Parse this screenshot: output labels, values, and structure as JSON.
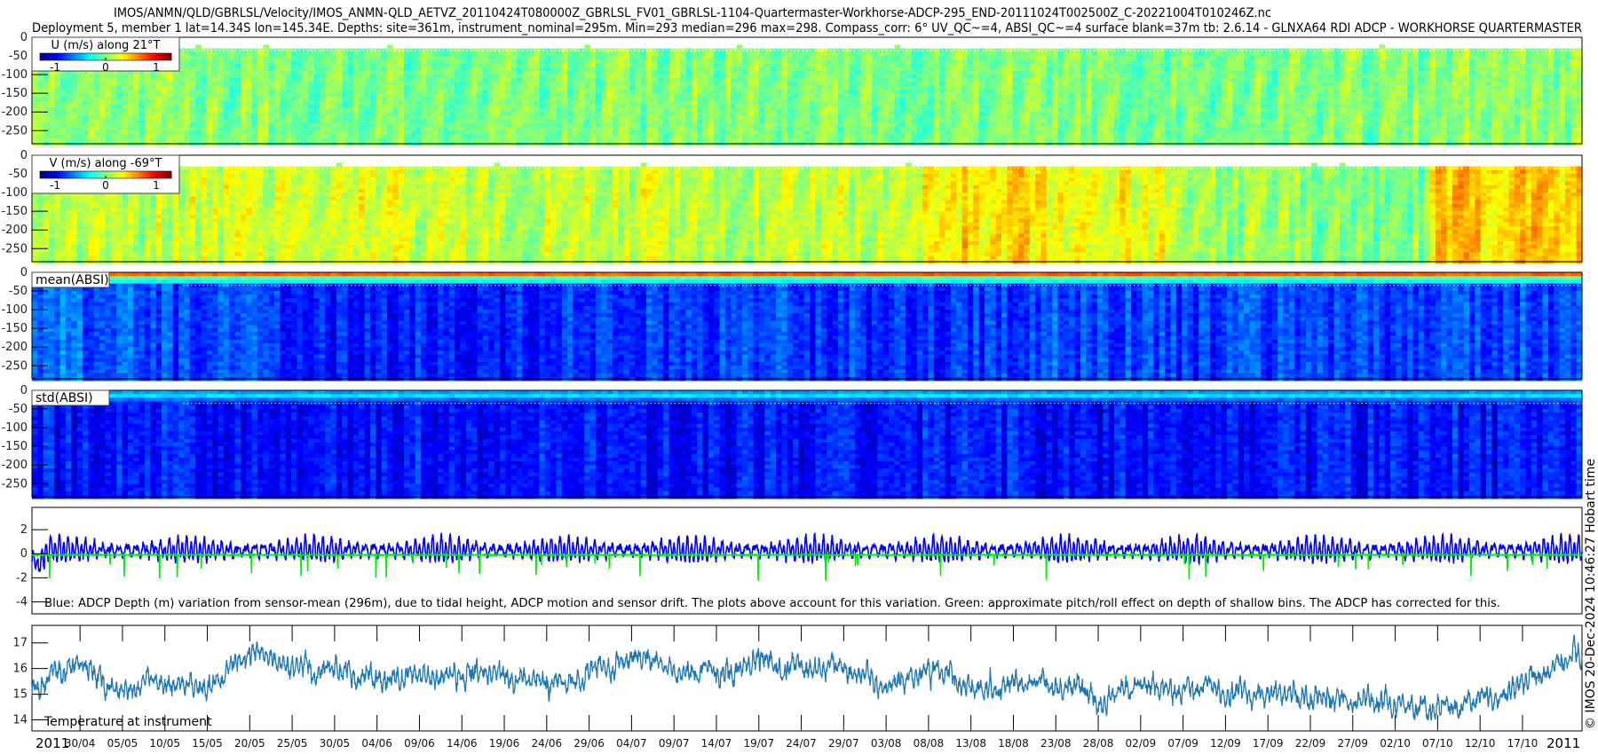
{
  "title": {
    "line1": "IMOS/ANMN/QLD/GBRLSL/Velocity/IMOS_ANMN-QLD_AETVZ_20110424T080000Z_GBRLSL_FV01_GBRLSL-1104-Quartermaster-Workhorse-ADCP-295_END-20111024T002500Z_C-20221004T010246Z.nc",
    "line2": "Deployment 5, member 1 lat=14.34S lon=145.34E. Depths: site=361m, instrument_nominal=295m. Min=293 median=296 max=298. Compass_corr: 6° UV_QC~=4, ABSI_QC~=4 surface blank=37m tb: 2.6.14 - GLNXA64 RDI ADCP - WORKHORSE QUARTERMASTER"
  },
  "credit": "© IMOS 20-Dec-2024 10:46:27 Hobart time",
  "colormap": "jet",
  "colors": {
    "depth_variation": "#0000ff",
    "pitch_roll": "#00ee00",
    "temperature": "#1f77b4",
    "surface_blank_line": "#ffffff"
  },
  "time_axis": {
    "start": "2011-04-24T08:00Z",
    "end": "2011-10-24T00:25Z",
    "year_label_left": "2011",
    "year_label_right": "2011",
    "ticks": [
      "30/04",
      "05/05",
      "10/05",
      "15/05",
      "20/05",
      "25/05",
      "30/05",
      "04/06",
      "09/06",
      "14/06",
      "19/06",
      "24/06",
      "29/06",
      "04/07",
      "09/07",
      "14/07",
      "19/07",
      "24/07",
      "29/07",
      "03/08",
      "08/08",
      "13/08",
      "18/08",
      "23/08",
      "28/08",
      "02/09",
      "07/09",
      "12/09",
      "17/09",
      "22/09",
      "27/09",
      "02/10",
      "07/10",
      "12/10",
      "17/10"
    ]
  },
  "chart_data": [
    {
      "type": "heatmap",
      "label": "U (m/s) along 21°T",
      "colorbar": {
        "ticks": [
          "-1",
          "0",
          "1"
        ],
        "tick_values": [
          -1,
          0,
          1
        ],
        "clim": [
          -1.3,
          1.3
        ]
      },
      "ylim": [
        -285,
        0
      ],
      "yticks": [
        0,
        -50,
        -100,
        -150,
        -200,
        -250
      ],
      "surface_blank_m": 37,
      "depths": [
        -40,
        -90,
        -140,
        -190,
        -240,
        -285
      ],
      "time_segment_start_dates": [
        "24/04",
        "09/05",
        "24/05",
        "08/06",
        "23/06",
        "08/07",
        "23/07",
        "07/08",
        "22/08",
        "06/09",
        "21/09",
        "06/10"
      ],
      "values": [
        [
          0.0,
          0.02,
          0.0,
          0.01,
          0.0,
          0.02,
          0.01,
          0.0,
          0.0,
          0.01,
          0.0,
          0.05
        ],
        [
          0.0,
          0.01,
          0.0,
          0.0,
          0.0,
          0.01,
          0.0,
          0.0,
          0.0,
          0.0,
          0.0,
          0.03
        ],
        [
          0.0,
          0.0,
          0.0,
          0.0,
          0.0,
          0.0,
          0.0,
          0.0,
          0.0,
          0.0,
          0.0,
          0.02
        ],
        [
          0.0,
          0.0,
          0.0,
          0.0,
          0.0,
          0.0,
          0.0,
          0.0,
          0.0,
          0.0,
          0.0,
          0.0
        ],
        [
          0.0,
          0.0,
          0.0,
          0.0,
          0.0,
          0.0,
          0.0,
          0.0,
          0.0,
          0.0,
          0.0,
          0.0
        ],
        [
          0.0,
          0.0,
          0.0,
          0.0,
          0.0,
          0.0,
          0.0,
          0.0,
          0.0,
          0.0,
          0.0,
          0.0
        ]
      ]
    },
    {
      "type": "heatmap",
      "label": "V (m/s) along -69°T",
      "colorbar": {
        "ticks": [
          "-1",
          "0",
          "1"
        ],
        "tick_values": [
          -1,
          0,
          1
        ],
        "clim": [
          -1.3,
          1.3
        ]
      },
      "ylim": [
        -285,
        0
      ],
      "yticks": [
        0,
        -50,
        -100,
        -150,
        -200,
        -250
      ],
      "surface_blank_m": 37,
      "depths": [
        -40,
        -90,
        -140,
        -190,
        -240,
        -285
      ],
      "time_segment_start_dates": [
        "24/04",
        "09/05",
        "24/05",
        "08/06",
        "23/06",
        "08/07",
        "23/07",
        "07/08",
        "22/08",
        "06/09",
        "21/09",
        "06/10"
      ],
      "values": [
        [
          0.15,
          0.2,
          0.25,
          0.15,
          0.2,
          0.15,
          0.2,
          0.4,
          0.3,
          0.05,
          0.0,
          0.45
        ],
        [
          0.15,
          0.2,
          0.2,
          0.15,
          0.15,
          0.15,
          0.15,
          0.25,
          0.0,
          -0.1,
          -0.15,
          0.25
        ],
        [
          0.15,
          0.15,
          0.15,
          0.1,
          0.1,
          0.1,
          0.1,
          0.1,
          -0.15,
          -0.2,
          -0.2,
          0.1
        ],
        [
          0.15,
          0.15,
          0.15,
          0.1,
          0.1,
          0.1,
          0.05,
          0.0,
          -0.2,
          -0.2,
          -0.15,
          0.05
        ],
        [
          0.1,
          0.15,
          0.15,
          0.1,
          0.1,
          0.1,
          0.05,
          0.0,
          -0.1,
          -0.1,
          -0.05,
          0.05
        ],
        [
          0.1,
          0.1,
          0.1,
          0.1,
          0.1,
          0.1,
          0.05,
          0.05,
          0.0,
          0.0,
          0.0,
          0.05
        ]
      ]
    },
    {
      "type": "heatmap",
      "label": "mean(ABSI)",
      "value_scale": "colormap fraction 0-1",
      "ylim": [
        -285,
        0
      ],
      "yticks": [
        0,
        -50,
        -100,
        -150,
        -200,
        -250
      ],
      "surface_blank_m": 37,
      "surface_rows": {
        "depths": [
          -8,
          -20,
          -30
        ],
        "values": [
          0.78,
          0.45,
          0.38
        ]
      },
      "depths": [
        -40,
        -90,
        -140,
        -190,
        -240,
        -285
      ],
      "time_segment_start_dates": [
        "24/04",
        "09/05",
        "24/05",
        "08/06",
        "23/06",
        "08/07",
        "23/07",
        "07/08",
        "22/08",
        "06/09",
        "21/09",
        "06/10"
      ],
      "values": [
        [
          0.22,
          0.18,
          0.15,
          0.15,
          0.18,
          0.18,
          0.17,
          0.17,
          0.2,
          0.18,
          0.17,
          0.2
        ],
        [
          0.3,
          0.27,
          0.25,
          0.25,
          0.27,
          0.27,
          0.26,
          0.27,
          0.3,
          0.3,
          0.3,
          0.3
        ],
        [
          0.4,
          0.36,
          0.35,
          0.36,
          0.38,
          0.37,
          0.36,
          0.38,
          0.38,
          0.4,
          0.4,
          0.4
        ],
        [
          0.52,
          0.48,
          0.47,
          0.48,
          0.5,
          0.49,
          0.48,
          0.5,
          0.45,
          0.45,
          0.45,
          0.47
        ],
        [
          0.62,
          0.6,
          0.58,
          0.6,
          0.6,
          0.6,
          0.6,
          0.58,
          0.52,
          0.52,
          0.52,
          0.55
        ],
        [
          0.75,
          0.72,
          0.72,
          0.72,
          0.72,
          0.72,
          0.72,
          0.7,
          0.62,
          0.62,
          0.62,
          0.65
        ]
      ]
    },
    {
      "type": "heatmap",
      "label": "std(ABSI)",
      "value_scale": "colormap fraction 0-1",
      "ylim": [
        -285,
        0
      ],
      "yticks": [
        0,
        -50,
        -100,
        -150,
        -200,
        -250
      ],
      "surface_blank_m": 37,
      "surface_rows": {
        "depths": [
          -8,
          -20,
          -30
        ],
        "values": [
          0.28,
          0.35,
          0.22
        ]
      },
      "depths": [
        -40,
        -90,
        -140,
        -190,
        -240,
        -285
      ],
      "time_segment_start_dates": [
        "24/04",
        "09/05",
        "24/05",
        "08/06",
        "23/06",
        "08/07",
        "23/07",
        "07/08",
        "22/08",
        "06/09",
        "21/09",
        "06/10"
      ],
      "values": [
        [
          0.14,
          0.14,
          0.14,
          0.14,
          0.14,
          0.14,
          0.14,
          0.14,
          0.14,
          0.14,
          0.14,
          0.14
        ],
        [
          0.14,
          0.14,
          0.14,
          0.14,
          0.14,
          0.14,
          0.14,
          0.14,
          0.14,
          0.14,
          0.14,
          0.14
        ],
        [
          0.15,
          0.15,
          0.15,
          0.15,
          0.15,
          0.15,
          0.15,
          0.15,
          0.15,
          0.15,
          0.15,
          0.15
        ],
        [
          0.16,
          0.16,
          0.16,
          0.16,
          0.16,
          0.16,
          0.16,
          0.16,
          0.16,
          0.16,
          0.16,
          0.16
        ],
        [
          0.18,
          0.18,
          0.18,
          0.18,
          0.18,
          0.18,
          0.18,
          0.18,
          0.18,
          0.18,
          0.18,
          0.18
        ],
        [
          0.2,
          0.2,
          0.2,
          0.2,
          0.2,
          0.2,
          0.2,
          0.2,
          0.2,
          0.2,
          0.2,
          0.2
        ]
      ]
    },
    {
      "type": "line",
      "annotation": "Blue: ADCP Depth (m) variation from sensor-mean (296m), due to tidal height, ADCP motion and sensor drift. The plots above account for this variation. Green: approximate pitch/roll effect on depth of shallow bins. The ADCP has corrected for this.",
      "ylim": [
        -5,
        3.85
      ],
      "yticks": [
        2,
        0,
        -2,
        -4
      ],
      "ytick_labels": [
        "2",
        "0",
        "-2",
        "-4"
      ],
      "series": [
        {
          "color": "#0000ff",
          "typical_range": [
            -1.5,
            2.1
          ],
          "mean": 0.3
        },
        {
          "color": "#00ee00",
          "typical_range": [
            -2.4,
            0.1
          ],
          "mean": -0.1
        }
      ]
    },
    {
      "type": "line",
      "annotation": "Temperature at instrument",
      "ylim": [
        13.57,
        17.68
      ],
      "yticks": [
        17,
        16,
        15,
        14
      ],
      "ytick_labels": [
        "17",
        "16",
        "15",
        "14"
      ],
      "x": [
        "24/04",
        "30/04",
        "05/05",
        "10/05",
        "15/05",
        "20/05",
        "25/05",
        "30/05",
        "04/06",
        "09/06",
        "14/06",
        "19/06",
        "24/06",
        "29/06",
        "04/07",
        "09/07",
        "14/07",
        "19/07",
        "24/07",
        "29/07",
        "03/08",
        "08/08",
        "13/08",
        "18/08",
        "23/08",
        "28/08",
        "02/09",
        "07/09",
        "12/09",
        "17/09",
        "22/09",
        "27/09",
        "02/10",
        "07/10",
        "12/10",
        "17/10",
        "24/10"
      ],
      "values": [
        15.2,
        16.3,
        15.0,
        15.3,
        15.2,
        16.4,
        16.2,
        15.8,
        15.5,
        15.7,
        15.7,
        15.6,
        15.5,
        15.8,
        16.4,
        16.0,
        15.7,
        16.3,
        16.0,
        16.0,
        15.3,
        16.0,
        15.3,
        15.4,
        15.5,
        14.8,
        15.2,
        15.3,
        15.0,
        15.1,
        14.9,
        14.8,
        14.6,
        14.4,
        14.8,
        15.3,
        16.6
      ],
      "color": "#1f77b4"
    }
  ]
}
